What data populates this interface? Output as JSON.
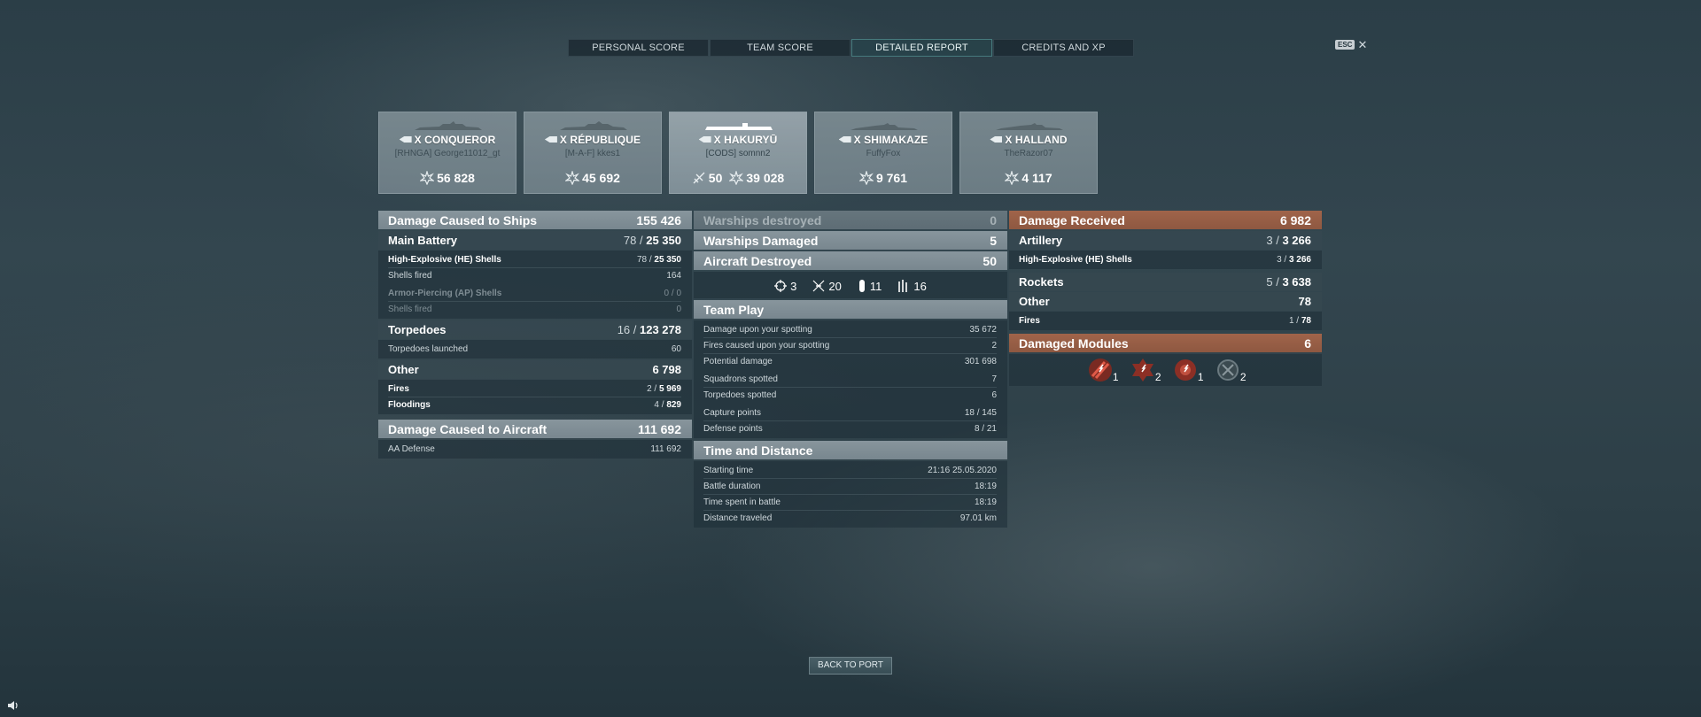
{
  "tabs": [
    {
      "label": "PERSONAL SCORE"
    },
    {
      "label": "TEAM SCORE"
    },
    {
      "label": "DETAILED REPORT"
    },
    {
      "label": "CREDITS AND XP"
    }
  ],
  "esc": {
    "key": "ESC",
    "close": "✕"
  },
  "players": [
    {
      "ship": "X CONQUEROR",
      "player": "[RHNGA] George11012_gt",
      "damage": "56 828"
    },
    {
      "ship": "X RÉPUBLIQUE",
      "player": "[M-A-F] kkes1",
      "damage": "45 692"
    },
    {
      "ship": "X HAKURYŪ",
      "player": "[CODS] somnn2",
      "kills": "50",
      "damage": "39 028"
    },
    {
      "ship": "X SHIMAKAZE",
      "player": "FuffyFox",
      "damage": "9 761"
    },
    {
      "ship": "X HALLAND",
      "player": "TheRazor07",
      "damage": "4 117"
    }
  ],
  "damage_ships": {
    "title": "Damage Caused to Ships",
    "value": "155 426",
    "main_battery": {
      "label": "Main Battery",
      "hits": "78",
      "dmg": "25 350"
    },
    "he_label": "High-Explosive (HE) Shells",
    "he_hits": "78",
    "he_dmg": "25 350",
    "he_fired_label": "Shells fired",
    "he_fired": "164",
    "ap_label": "Armor-Piercing (AP) Shells",
    "ap_hits": "0",
    "ap_dmg": "0",
    "ap_fired_label": "Shells fired",
    "ap_fired": "0",
    "torpedoes": {
      "label": "Torpedoes",
      "hits": "16",
      "dmg": "123 278"
    },
    "torp_launched_label": "Torpedoes launched",
    "torp_launched": "60",
    "other": {
      "label": "Other",
      "value": "6 798"
    },
    "fires_label": "Fires",
    "fires_hits": "2",
    "fires_dmg": "5 969",
    "flood_label": "Floodings",
    "flood_hits": "4",
    "flood_dmg": "829"
  },
  "damage_aircraft": {
    "title": "Damage Caused to Aircraft",
    "value": "111 692",
    "aa_label": "AA Defense",
    "aa_value": "111 692"
  },
  "center": {
    "destroyed": {
      "label": "Warships destroyed",
      "value": "0"
    },
    "damaged": {
      "label": "Warships Damaged",
      "value": "5"
    },
    "aircraft": {
      "label": "Aircraft Destroyed",
      "value": "50"
    },
    "awards": [
      {
        "icon": "crosshair-icon",
        "count": "3"
      },
      {
        "icon": "plane-kill-icon",
        "count": "20"
      },
      {
        "icon": "bomb-icon",
        "count": "11"
      },
      {
        "icon": "torpedo-icon",
        "count": "16"
      }
    ]
  },
  "team_play": {
    "title": "Team Play",
    "spot_dmg_label": "Damage upon your spotting",
    "spot_dmg": "35 672",
    "spot_fires_label": "Fires caused upon your spotting",
    "spot_fires": "2",
    "potential_label": "Potential damage",
    "potential": "301 698",
    "squadrons_label": "Squadrons spotted",
    "squadrons": "7",
    "torps_label": "Torpedoes spotted",
    "torps": "6",
    "capture_label": "Capture points",
    "capture": "18 / 145",
    "defense_label": "Defense points",
    "defense": "8 / 21"
  },
  "time_distance": {
    "title": "Time and Distance",
    "start_label": "Starting time",
    "start": "21:16  25.05.2020",
    "duration_label": "Battle duration",
    "duration": "18:19",
    "spent_label": "Time spent in battle",
    "spent": "18:19",
    "distance_label": "Distance traveled",
    "distance": "97.01 km"
  },
  "received": {
    "title": "Damage Received",
    "value": "6 982",
    "artillery": {
      "label": "Artillery",
      "hits": "3",
      "dmg": "3 266"
    },
    "he_label": "High-Explosive (HE) Shells",
    "he_hits": "3",
    "he_dmg": "3 266",
    "rockets": {
      "label": "Rockets",
      "hits": "5",
      "dmg": "3 638"
    },
    "other": {
      "label": "Other",
      "value": "78"
    },
    "fires_label": "Fires",
    "fires_hits": "1",
    "fires_dmg": "78"
  },
  "modules": {
    "title": "Damaged Modules",
    "value": "6",
    "items": [
      {
        "icon": "torpedo-tubes-module-icon",
        "count": "1"
      },
      {
        "icon": "aa-mount-module-icon",
        "count": "2"
      },
      {
        "icon": "secondary-battery-module-icon",
        "count": "1"
      },
      {
        "icon": "engine-module-icon",
        "count": "2"
      }
    ]
  },
  "back": "BACK TO PORT",
  "colors": {
    "accent_orange": "#a0644a",
    "panel_gray": "#919ea5",
    "active_tab": "#28424a"
  }
}
